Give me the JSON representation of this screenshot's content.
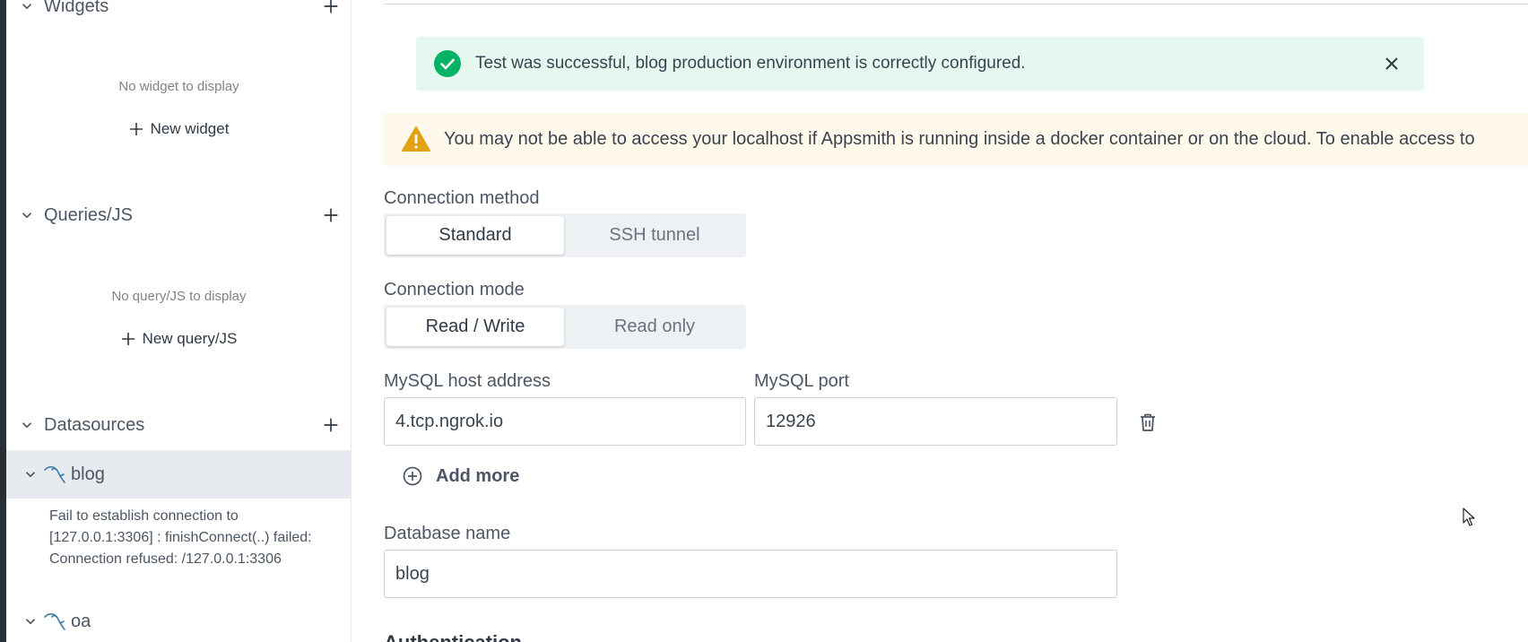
{
  "sidebar": {
    "widgets": {
      "title": "Widgets",
      "empty_text": "No widget to display",
      "new_label": "New widget"
    },
    "queries": {
      "title": "Queries/JS",
      "empty_text": "No query/JS to display",
      "new_label": "New query/JS"
    },
    "datasources": {
      "title": "Datasources",
      "items": [
        {
          "name": "blog",
          "error": "Fail to establish connection to [127.0.0.1:3306] : finishConnect(..) failed: Connection refused: /127.0.0.1:3306"
        },
        {
          "name": "oa"
        }
      ]
    }
  },
  "main": {
    "toast": {
      "message": "Test was successful, blog production environment is correctly configured."
    },
    "warning": {
      "message": "You may not be able to access your localhost if Appsmith is running inside a docker container or on the cloud. To enable access to"
    },
    "connection_method": {
      "label": "Connection method",
      "options": [
        "Standard",
        "SSH tunnel"
      ],
      "selected": "Standard"
    },
    "connection_mode": {
      "label": "Connection mode",
      "options": [
        "Read / Write",
        "Read only"
      ],
      "selected": "Read / Write"
    },
    "host": {
      "label": "MySQL host address",
      "value": "4.tcp.ngrok.io"
    },
    "port": {
      "label": "MySQL port",
      "value": "12926"
    },
    "add_more_label": "Add more",
    "database": {
      "label": "Database name",
      "value": "blog"
    },
    "auth_heading": "Authentication"
  },
  "colors": {
    "success_bg": "#e6f7f0",
    "success_icon": "#03b365",
    "warning_bg": "#fff9ec",
    "warning_icon": "#e2a211",
    "selected_item_bg": "#e7ebef"
  }
}
